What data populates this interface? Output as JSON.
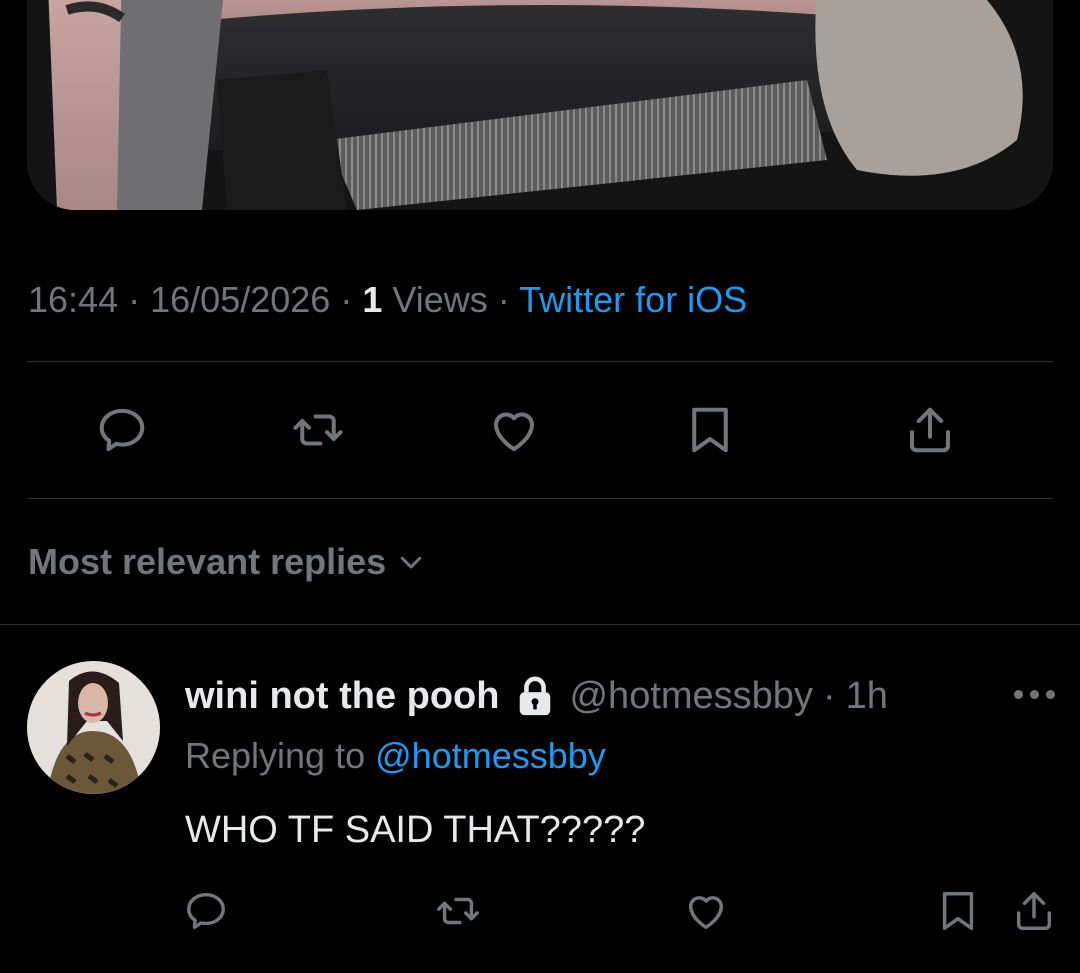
{
  "tweet": {
    "time": "16:44",
    "date": "16/05/2026",
    "views_count": "1",
    "views_label": "Views",
    "source": "Twitter for iOS",
    "separator": "·"
  },
  "actions": {
    "icons": [
      "reply-icon",
      "retweet-icon",
      "like-icon",
      "bookmark-icon",
      "share-icon"
    ]
  },
  "replies": {
    "sort_label": "Most relevant replies",
    "items": [
      {
        "display_name": "wini not the pooh",
        "handle": "@hotmessbby",
        "time_ago": "1h",
        "replying_prefix": "Replying to",
        "replying_to": "@hotmessbby",
        "text": "WHO TF SAID THAT?????"
      }
    ]
  },
  "colors": {
    "background": "#000000",
    "text_primary": "#e7e9ea",
    "text_secondary": "#71767b",
    "accent": "#1d9bf0",
    "divider": "#2f3336"
  }
}
